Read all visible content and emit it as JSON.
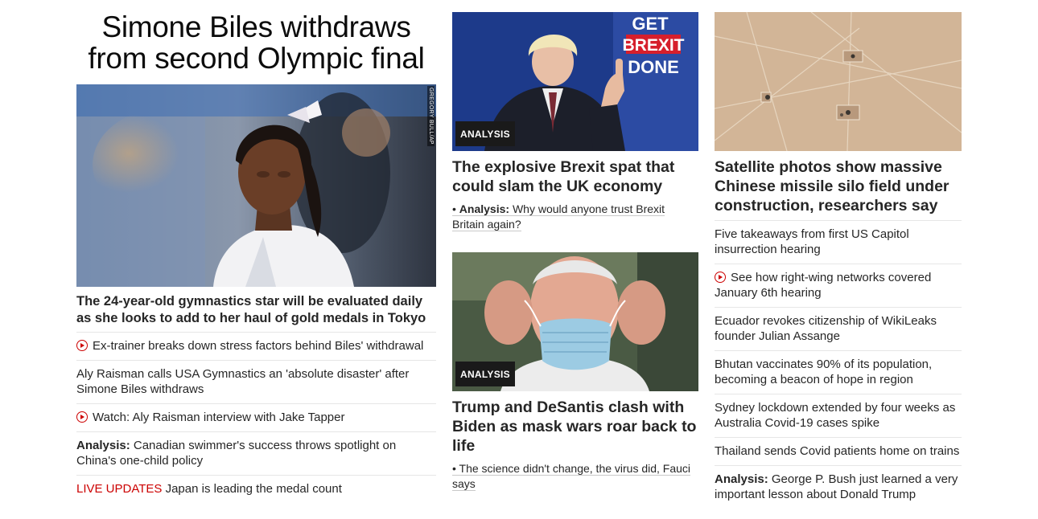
{
  "left": {
    "title": "Simone Biles withdraws from second Olympic final",
    "photo_credit": "GREGORY BULL/AP",
    "subhead": "The 24-year-old gymnastics star will be evaluated daily as she looks to add to her haul of gold medals in Tokyo",
    "links": [
      {
        "text": "Ex-trainer breaks down stress factors behind Biles' withdrawal",
        "video": true
      },
      {
        "text": "Aly Raisman calls USA Gymnastics an 'absolute disaster' after Simone Biles withdraws"
      },
      {
        "text": "Watch: Aly Raisman interview with Jake Tapper",
        "video": true
      },
      {
        "label": "Analysis:",
        "text": "Canadian swimmer's success throws spotlight on China's one-child policy"
      },
      {
        "live": "LIVE UPDATES",
        "text": "Japan is leading the medal count"
      }
    ]
  },
  "middle": {
    "card1": {
      "badge": "ANALYSIS",
      "sign_text": [
        "GET",
        "BREXIT",
        "DONE"
      ],
      "headline": "The explosive Brexit spat that could slam the UK economy",
      "bullet": "•",
      "sub_label": "Analysis:",
      "sub_text": "Why would anyone trust Brexit Britain again?"
    },
    "card2": {
      "badge": "ANALYSIS",
      "headline": "Trump and DeSantis clash with Biden as mask wars roar back to life",
      "bullet": "•",
      "sub_text": "The science didn't change, the virus did, Fauci says"
    }
  },
  "right": {
    "headline": "Satellite photos show massive Chinese missile silo field under construction, researchers say",
    "links": [
      {
        "text": "Five takeaways from first US Capitol insurrection hearing"
      },
      {
        "text": "See how right-wing networks covered January 6th hearing",
        "video": true
      },
      {
        "text": "Ecuador revokes citizenship of WikiLeaks founder Julian Assange"
      },
      {
        "text": "Bhutan vaccinates 90% of its population, becoming a beacon of hope in region"
      },
      {
        "text": "Sydney lockdown extended by four weeks as Australia Covid-19 cases spike"
      },
      {
        "text": "Thailand sends Covid patients home on trains"
      },
      {
        "label": "Analysis:",
        "text": "George P. Bush just learned a very important lesson about Donald Trump"
      }
    ]
  },
  "colors": {
    "accent_red": "#cc0000",
    "text": "#262626",
    "divider": "#e6e6e6"
  },
  "icons": {
    "video": "play-circle-icon"
  }
}
